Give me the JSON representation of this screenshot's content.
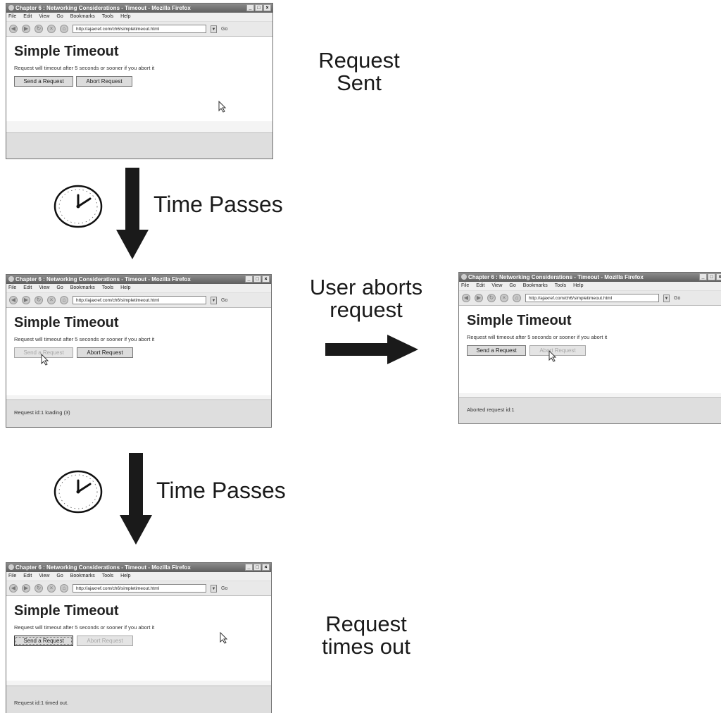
{
  "browser": {
    "window_title": "Chapter 6 : Networking Considerations - Timeout - Mozilla Firefox",
    "window_title_short": "Chapter 6 : Networking Considerations - Timeout - Mozilla Firefox",
    "menu": [
      "File",
      "Edit",
      "View",
      "Go",
      "Bookmarks",
      "Tools",
      "Help"
    ],
    "url": "http://ajaxref.com/ch6/simpletimeout.html",
    "go_label": "Go",
    "page_heading": "Simple Timeout",
    "page_desc": "Request will timeout after 5 seconds or sooner if you abort it",
    "send_label": "Send a Request",
    "abort_label": "Abort Request"
  },
  "panels": {
    "sent": {
      "status": ""
    },
    "loading": {
      "status": "Request id:1 loading (3)"
    },
    "aborted": {
      "status": "Aborted request id:1"
    },
    "timedout": {
      "status": "Request id:1 timed out."
    }
  },
  "captions": {
    "request_sent": "Request\nSent",
    "time_passes_1": "Time Passes",
    "user_aborts": "User aborts\nrequest",
    "time_passes_2": "Time Passes",
    "times_out": "Request\ntimes out"
  },
  "colors": {
    "arrow": "#1a1a1a",
    "status_bar": "#dedede",
    "disabled_text": "#a8a8a8"
  },
  "icons": [
    "clock-icon",
    "arrow-down-icon",
    "arrow-right-icon",
    "cursor-icon"
  ]
}
